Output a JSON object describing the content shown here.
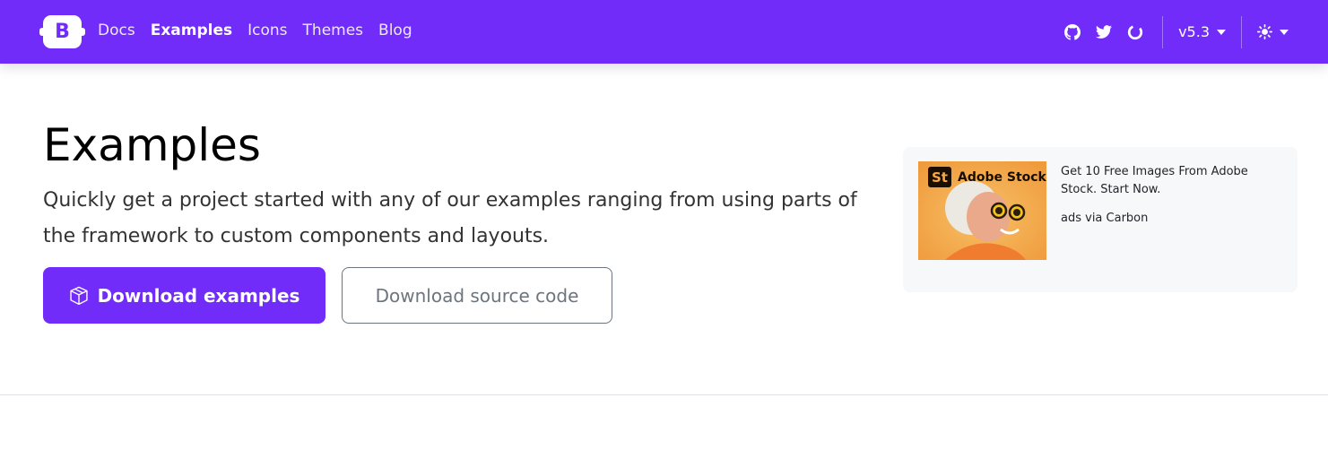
{
  "navbar": {
    "brand_letter": "B",
    "links": [
      {
        "label": "Docs",
        "active": false
      },
      {
        "label": "Examples",
        "active": true
      },
      {
        "label": "Icons",
        "active": false
      },
      {
        "label": "Themes",
        "active": false
      },
      {
        "label": "Blog",
        "active": false
      }
    ],
    "icons": [
      "github-icon",
      "twitter-icon",
      "opencollective-icon"
    ],
    "version_label": "v5.3",
    "theme_icon": "sun-icon",
    "background_color": "#712cf9"
  },
  "hero": {
    "title": "Examples",
    "lead": "Quickly get a project started with any of our examples ranging from using parts of the framework to custom components and layouts.",
    "primary_button": "Download examples",
    "primary_icon": "box-icon",
    "secondary_button": "Download source code"
  },
  "ad": {
    "logo_badge": "St",
    "logo_text": "Adobe Stock",
    "text": "Get 10 Free Images From Adobe Stock. Start Now.",
    "via": "ads via Carbon"
  },
  "colors": {
    "accent": "#712cf9",
    "secondary": "#6c757d",
    "ad_background": "#f7f8fa"
  }
}
